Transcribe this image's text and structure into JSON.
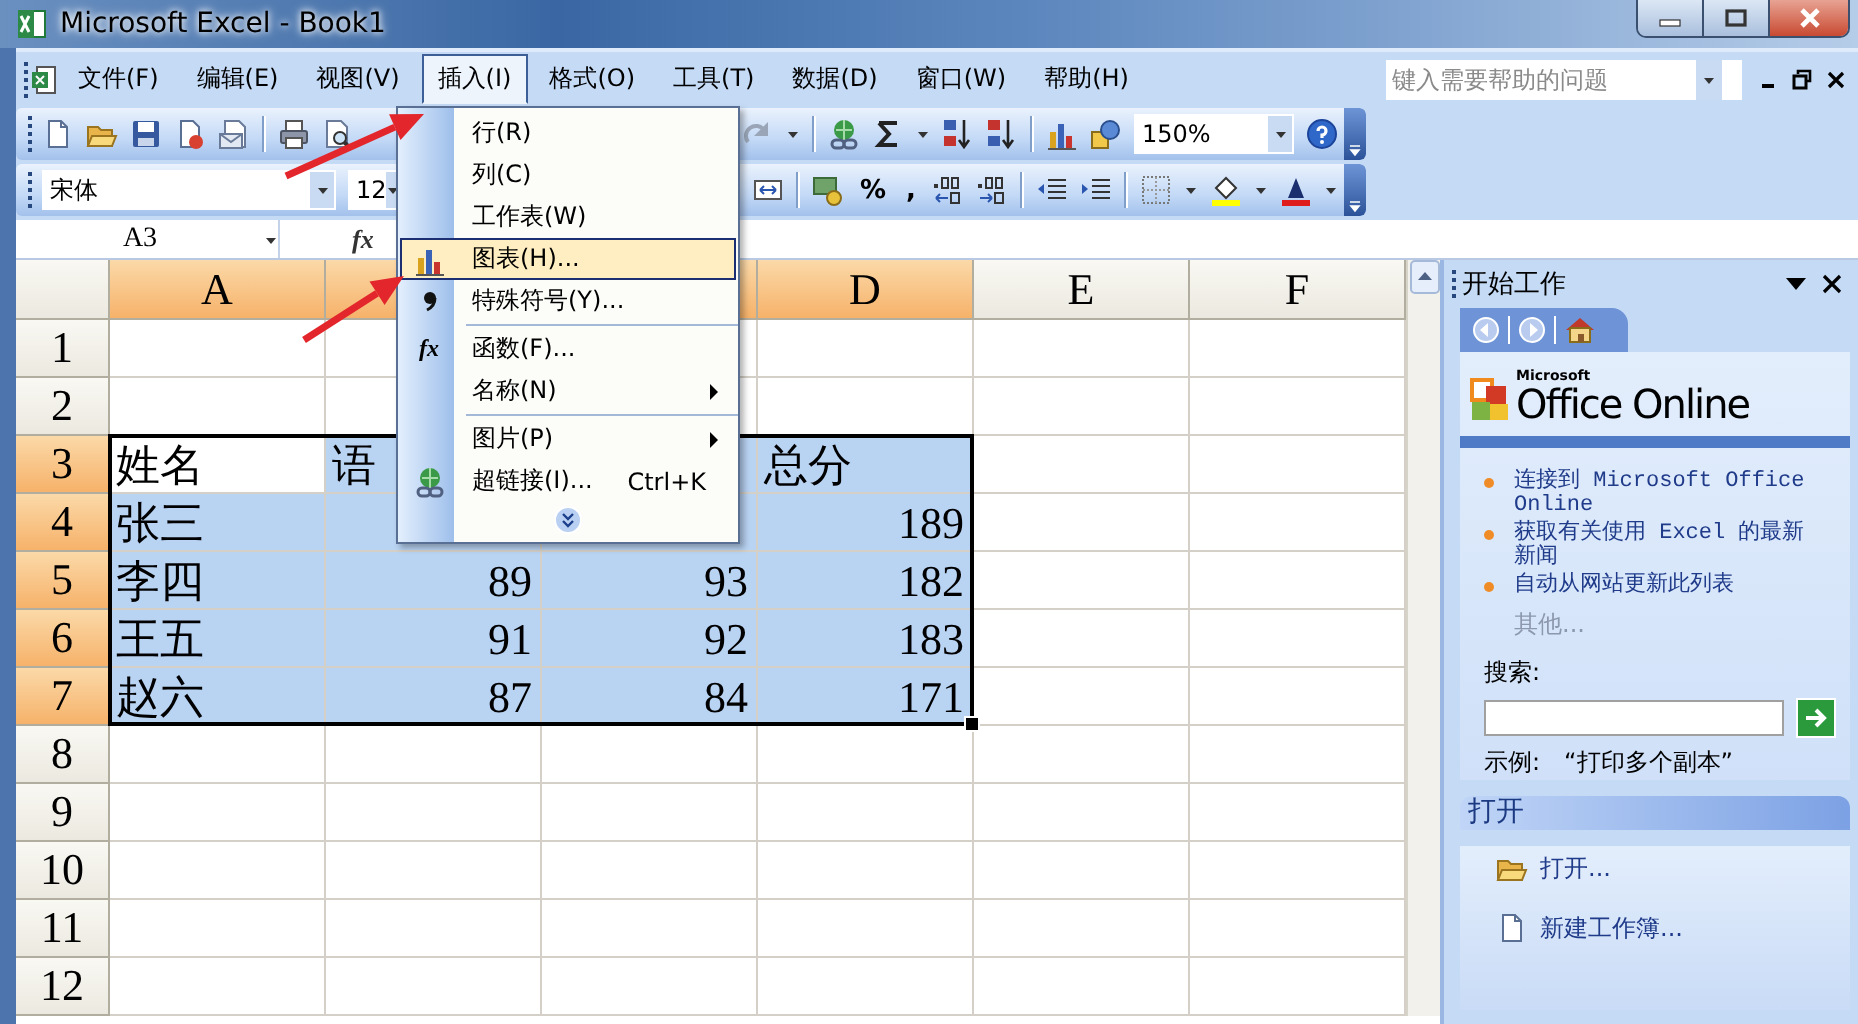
{
  "window": {
    "title": "Microsoft Excel - Book1"
  },
  "menu_bar": {
    "items": [
      {
        "label": "文件(F)",
        "selected": false
      },
      {
        "label": "编辑(E)",
        "selected": false
      },
      {
        "label": "视图(V)",
        "selected": false
      },
      {
        "label": "插入(I)",
        "selected": true
      },
      {
        "label": "格式(O)",
        "selected": false
      },
      {
        "label": "工具(T)",
        "selected": false
      },
      {
        "label": "数据(D)",
        "selected": false
      },
      {
        "label": "窗口(W)",
        "selected": false
      },
      {
        "label": "帮助(H)",
        "selected": false
      }
    ],
    "help_box": {
      "placeholder": "键入需要帮助的问题"
    }
  },
  "standard_toolbar": {
    "zoom": "150%"
  },
  "formatting_toolbar": {
    "font": "宋体",
    "size": "12",
    "percent": "%",
    "comma": ","
  },
  "formula_bar": {
    "name_box": "A3",
    "function_glyph": "fx"
  },
  "sheet": {
    "columns": [
      {
        "label": "A",
        "selected": true
      },
      {
        "selected": true
      },
      {
        "selected": true
      },
      {
        "label": "D",
        "selected": true
      },
      {
        "label": "E",
        "selected": false
      },
      {
        "label": "F",
        "selected": false
      }
    ],
    "rows": [
      {
        "header": "1",
        "selected": false
      },
      {
        "header": "2",
        "selected": false
      },
      {
        "header": "3",
        "selected": true,
        "cells": [
          {
            "text": "姓名",
            "kind": "text",
            "active": true
          },
          {
            "text": "语",
            "kind": "text",
            "active": false
          },
          null,
          {
            "text": "总分",
            "kind": "text",
            "active": false
          }
        ]
      },
      {
        "header": "4",
        "selected": true,
        "cells": [
          {
            "text": "张三",
            "kind": "text",
            "active": false
          },
          null,
          null,
          {
            "text": "189",
            "kind": "number",
            "active": false
          }
        ]
      },
      {
        "header": "5",
        "selected": true,
        "cells": [
          {
            "text": "李四",
            "kind": "text",
            "active": false
          },
          {
            "text": "89",
            "kind": "number",
            "active": false
          },
          {
            "text": "93",
            "kind": "number",
            "active": false
          },
          {
            "text": "182",
            "kind": "number",
            "active": false
          }
        ]
      },
      {
        "header": "6",
        "selected": true,
        "cells": [
          {
            "text": "王五",
            "kind": "text",
            "active": false
          },
          {
            "text": "91",
            "kind": "number",
            "active": false
          },
          {
            "text": "92",
            "kind": "number",
            "active": false
          },
          {
            "text": "183",
            "kind": "number",
            "active": false
          }
        ]
      },
      {
        "header": "7",
        "selected": true,
        "cells": [
          {
            "text": "赵六",
            "kind": "text",
            "active": false
          },
          {
            "text": "87",
            "kind": "number",
            "active": false
          },
          {
            "text": "84",
            "kind": "number",
            "active": false
          },
          {
            "text": "171",
            "kind": "number",
            "active": false
          }
        ]
      },
      {
        "header": "8",
        "selected": false
      },
      {
        "header": "9",
        "selected": false
      },
      {
        "header": "10",
        "selected": false
      },
      {
        "header": "11",
        "selected": false
      },
      {
        "header": "12",
        "selected": false
      }
    ]
  },
  "insert_menu": {
    "items": [
      {
        "kind": "plain",
        "label": "行(R)",
        "selected": false,
        "submenu": false
      },
      {
        "kind": "plain",
        "label": "列(C)",
        "selected": false,
        "submenu": false
      },
      {
        "kind": "plain",
        "label": "工作表(W)",
        "selected": false,
        "submenu": false
      },
      {
        "kind": "chart",
        "label": "图表(H)...",
        "selected": true,
        "submenu": false
      },
      {
        "kind": "symbol",
        "label": "特殊符号(Y)...",
        "selected": false,
        "submenu": false
      },
      {
        "kind": "separator"
      },
      {
        "kind": "function",
        "glyph": "fx",
        "label": "函数(F)...",
        "selected": false,
        "submenu": false
      },
      {
        "kind": "plain",
        "label": "名称(N)",
        "selected": false,
        "submenu": true
      },
      {
        "kind": "separator"
      },
      {
        "kind": "plain",
        "label": "图片(P)",
        "selected": false,
        "submenu": true
      },
      {
        "kind": "link",
        "label": "超链接(I)...",
        "shortcut": "Ctrl+K",
        "selected": false,
        "submenu": false
      },
      {
        "kind": "expand"
      }
    ]
  },
  "task_pane": {
    "title": "开始工作",
    "logo": {
      "maker": "Microsoft",
      "product": "Office Online"
    },
    "links": [
      "连接到 Microsoft Office Online",
      "获取有关使用 Excel 的最新新闻",
      "自动从网站更新此列表"
    ],
    "more": "其他...",
    "search": {
      "label": "搜索:",
      "example_label": "示例:",
      "example": "“打印多个副本”"
    },
    "open_section": {
      "title": "打开",
      "items": [
        {
          "kind": "folder",
          "label": "打开..."
        },
        {
          "kind": "document",
          "label": "新建工作簿..."
        }
      ]
    }
  }
}
